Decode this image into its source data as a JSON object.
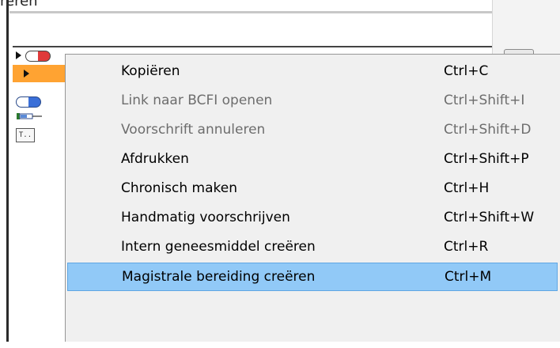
{
  "background": {
    "top_text": "reren",
    "row_doc_icon_text": "T.."
  },
  "context_menu": {
    "items": [
      {
        "label": "Kopiëren",
        "shortcut": "Ctrl+C",
        "enabled": true,
        "highlighted": false
      },
      {
        "label": "Link naar BCFI openen",
        "shortcut": "Ctrl+Shift+I",
        "enabled": false,
        "highlighted": false
      },
      {
        "label": "Voorschrift annuleren",
        "shortcut": "Ctrl+Shift+D",
        "enabled": false,
        "highlighted": false
      },
      {
        "label": "Afdrukken",
        "shortcut": "Ctrl+Shift+P",
        "enabled": true,
        "highlighted": false
      },
      {
        "label": "Chronisch maken",
        "shortcut": "Ctrl+H",
        "enabled": true,
        "highlighted": false
      },
      {
        "label": "Handmatig voorschrijven",
        "shortcut": "Ctrl+Shift+W",
        "enabled": true,
        "highlighted": false
      },
      {
        "label": "Intern geneesmiddel creëren",
        "shortcut": "Ctrl+R",
        "enabled": true,
        "highlighted": false
      },
      {
        "label": "Magistrale bereiding creëren",
        "shortcut": "Ctrl+M",
        "enabled": true,
        "highlighted": true
      }
    ]
  },
  "colors": {
    "highlight": "#91c9f7",
    "highlight_border": "#5fa6e3",
    "menu_background": "#f0f0f0",
    "disabled_text": "#6d6d6d",
    "selected_row": "#ffa332"
  }
}
